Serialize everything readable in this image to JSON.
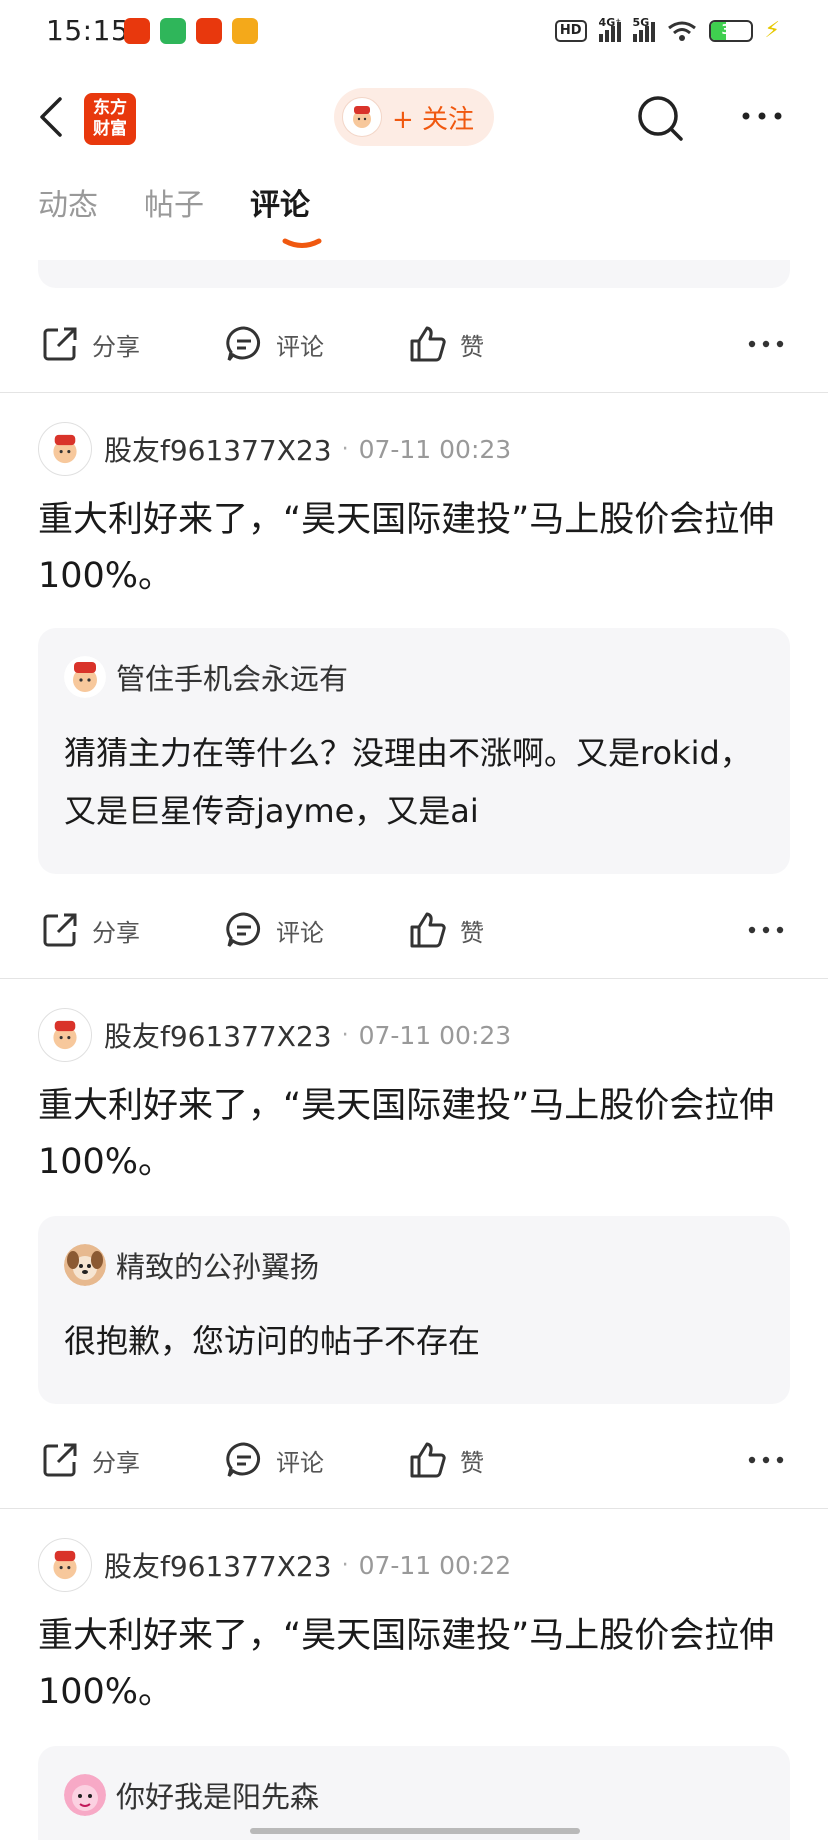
{
  "status_bar": {
    "time": "15:15",
    "hd": "HD",
    "net1": "4G⁺",
    "net2": "5G",
    "battery": "39"
  },
  "header": {
    "logo_text": "东方\n财富",
    "follow_label": "+ 关注"
  },
  "tabs": [
    {
      "label": "动态",
      "active": false
    },
    {
      "label": "帖子",
      "active": false
    },
    {
      "label": "评论",
      "active": true
    }
  ],
  "actions": {
    "share": "分享",
    "comment": "评论",
    "like": "赞"
  },
  "posts": [
    {
      "author": "股友f961377X23",
      "dot": "·",
      "time": "07-11 00:23",
      "text": "重大利好来了，“昊天国际建投”马上股价会拉伸100%。",
      "quote": {
        "author": "管住手机会永远有",
        "text": "猜猜主力在等什么？没理由不涨啊。又是rokid，又是巨星传奇jayme，又是ai"
      }
    },
    {
      "author": "股友f961377X23",
      "dot": "·",
      "time": "07-11 00:23",
      "text": "重大利好来了，“昊天国际建投”马上股价会拉伸100%。",
      "quote": {
        "author": "精致的公孙翼扬",
        "text": "很抱歉，您访问的帖子不存在"
      }
    },
    {
      "author": "股友f961377X23",
      "dot": "·",
      "time": "07-11 00:22",
      "text": "重大利好来了，“昊天国际建投”马上股价会拉伸100%。",
      "quote": {
        "author": "你好我是阳先森",
        "text": ""
      }
    }
  ],
  "colors": {
    "accent": "#f0580f",
    "brand": "#e8380d",
    "quote_bg": "#f6f6f8"
  }
}
